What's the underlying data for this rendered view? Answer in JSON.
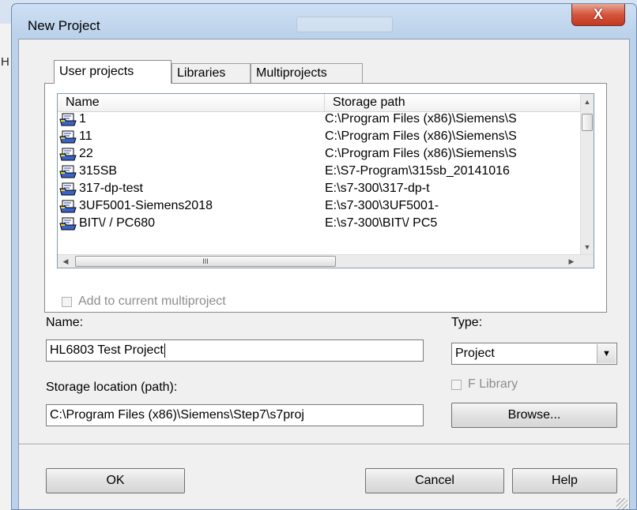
{
  "background": {
    "strip_letter": "H"
  },
  "window": {
    "title": "New Project",
    "close_glyph": "X",
    "colors": {
      "titlebar": "#c5d8ef",
      "close_button": "#d4553c",
      "client": "#f0f0f0"
    }
  },
  "tabs": [
    {
      "label": "User projects",
      "active": true
    },
    {
      "label": "Libraries",
      "active": false
    },
    {
      "label": "Multiprojects",
      "active": false
    }
  ],
  "project_list": {
    "columns": [
      "Name",
      "Storage path"
    ],
    "rows": [
      {
        "name": "1",
        "path": "C:\\Program Files (x86)\\Siemens\\S"
      },
      {
        "name": "11",
        "path": "C:\\Program Files (x86)\\Siemens\\S"
      },
      {
        "name": "22",
        "path": "C:\\Program Files (x86)\\Siemens\\S"
      },
      {
        "name": "315SB",
        "path": "E:\\S7-Program\\315sb_20141016"
      },
      {
        "name": "317-dp-test",
        "path": "E:\\s7-300\\317-dp-t"
      },
      {
        "name": "3UF5001-Siemens2018",
        "path": "E:\\s7-300\\3UF5001-"
      },
      {
        "name": "BIT\\/ / PC680",
        "path": "E:\\s7-300\\BIT\\/ PC5"
      }
    ],
    "icon": "project-icon",
    "hscroll_thumb_glyph": "III"
  },
  "add_to_multiproject": {
    "label": "Add to current multiproject",
    "checked": false,
    "enabled": false
  },
  "name_field": {
    "label": "Name:",
    "value": "HL6803 Test Project"
  },
  "type_field": {
    "label": "Type:",
    "value": "Project"
  },
  "f_library": {
    "label": "F Library",
    "checked": false,
    "enabled": false
  },
  "storage_field": {
    "label": "Storage location (path):",
    "value": "C:\\Program Files (x86)\\Siemens\\Step7\\s7proj"
  },
  "buttons": {
    "browse": "Browse...",
    "ok": "OK",
    "cancel": "Cancel",
    "help": "Help"
  }
}
